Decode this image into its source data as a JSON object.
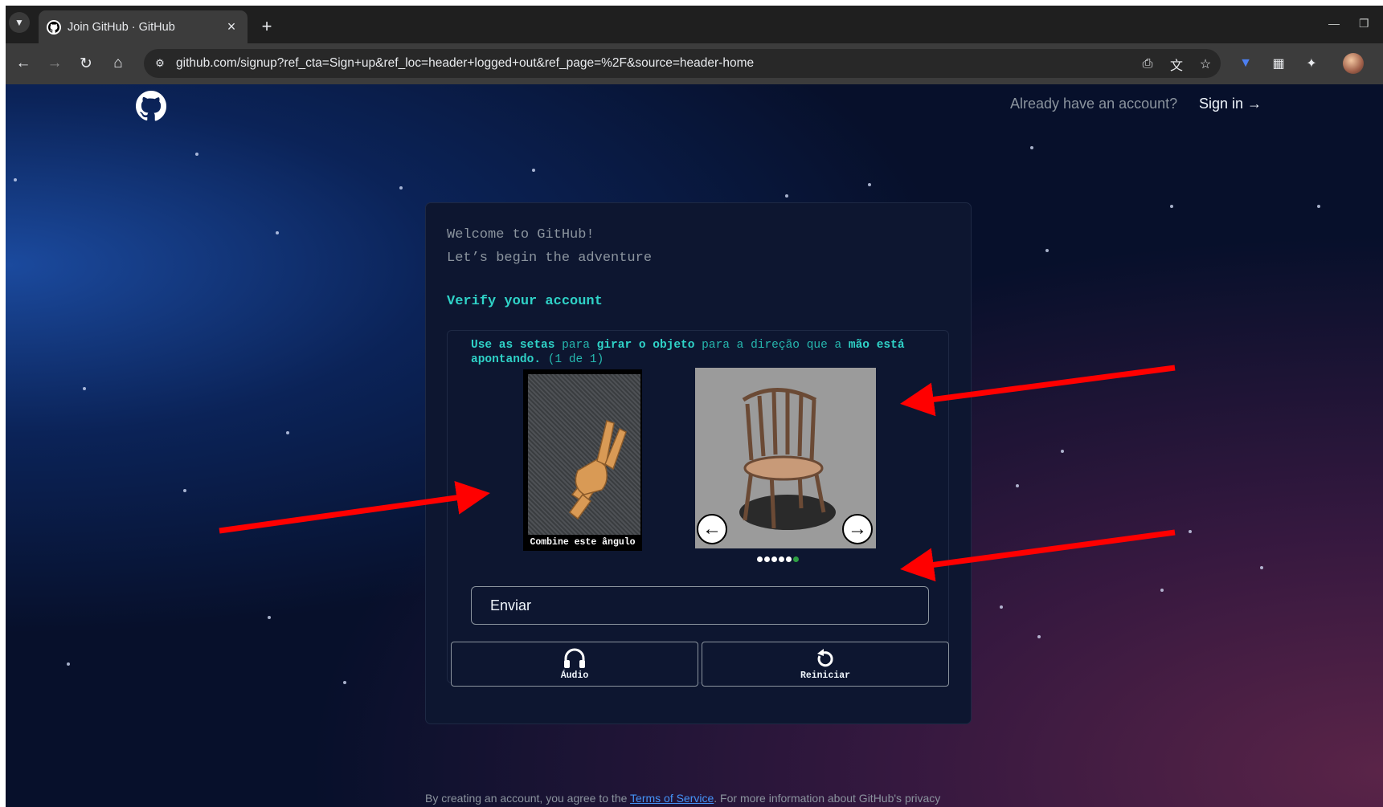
{
  "browser": {
    "tab_title": "Join GitHub · GitHub",
    "url": "github.com/signup?ref_cta=Sign+up&ref_loc=header+logged+out&ref_page=%2F&source=header-home"
  },
  "header": {
    "already_text": "Already have an account?",
    "signin_label": "Sign in →"
  },
  "card": {
    "welcome_line1": "Welcome to GitHub!",
    "welcome_line2": "Let’s begin the adventure",
    "verify_title": "Verify your account"
  },
  "captcha": {
    "instruction": {
      "p1": "Use as setas",
      "p2": "para",
      "p3": "girar o objeto",
      "p4": "para a direção que a",
      "p5": "mão",
      "p6": "está apontando.",
      "p7": "(1 de 1)"
    },
    "hand_caption": "Combine este ângulo",
    "dots": 6,
    "active_dot": 6,
    "submit_label": "Enviar",
    "audio_label": "Áudio",
    "restart_label": "Reiniciar"
  },
  "footer": {
    "text_before": "By creating an account, you agree to the",
    "terms_link": "Terms of Service",
    "text_after": ". For more information about GitHub's privacy"
  },
  "colors": {
    "accent_teal": "#2fd2c7",
    "annotation_red": "#ff0000",
    "link_blue": "#4493f8"
  }
}
